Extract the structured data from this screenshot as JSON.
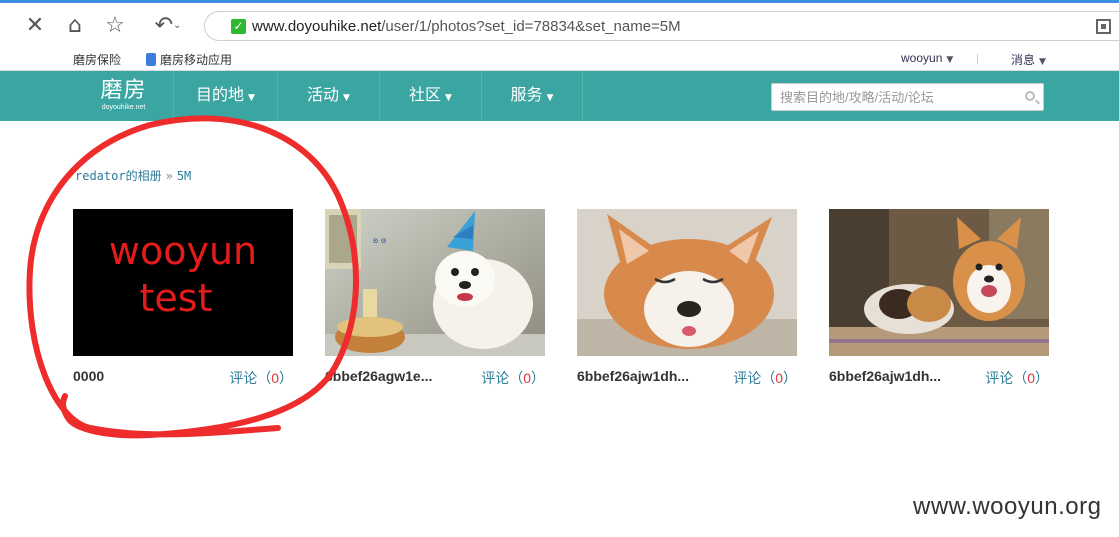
{
  "browser": {
    "url_host": "www.doyouhike.net",
    "url_path": "/user/1/photos?set_id=78834&set_name=5M"
  },
  "bookmarks": {
    "items": [
      {
        "label": "磨房保险"
      },
      {
        "label": "磨房移动应用"
      }
    ],
    "user": "wooyun",
    "messages": "消息"
  },
  "site": {
    "logo_cn": "磨房",
    "logo_en": "doyouhike.net",
    "nav": [
      {
        "label": "目的地"
      },
      {
        "label": "活动"
      },
      {
        "label": "社区"
      },
      {
        "label": "服务"
      }
    ],
    "search_placeholder": "搜索目的地/攻略/活动/论坛"
  },
  "breadcrumb": {
    "owner": "redator的相册",
    "separator": "»",
    "album": "5M"
  },
  "photos": [
    {
      "name": "0000",
      "comments_label": "评论（",
      "comments_count": "0",
      "comments_close": "）",
      "image_text_1": "wooyun",
      "image_text_2": "test"
    },
    {
      "name": "6bbef26agw1e...",
      "comments_label": "评论（",
      "comments_count": "0",
      "comments_close": "）"
    },
    {
      "name": "6bbef26ajw1dh...",
      "comments_label": "评论（",
      "comments_count": "0",
      "comments_close": "）"
    },
    {
      "name": "6bbef26ajw1dh...",
      "comments_label": "评论（",
      "comments_count": "0",
      "comments_close": "）"
    }
  ],
  "watermark": "www.wooyun.org",
  "colors": {
    "nav_bg": "#3aa5a1",
    "link": "#2d7d9a",
    "count_red": "#e03a3a",
    "annotation_red": "#ee2c2c"
  },
  "icons": [
    "close-icon",
    "home-icon",
    "star-icon",
    "undo-icon",
    "lock-icon",
    "qr-icon",
    "search-icon"
  ]
}
